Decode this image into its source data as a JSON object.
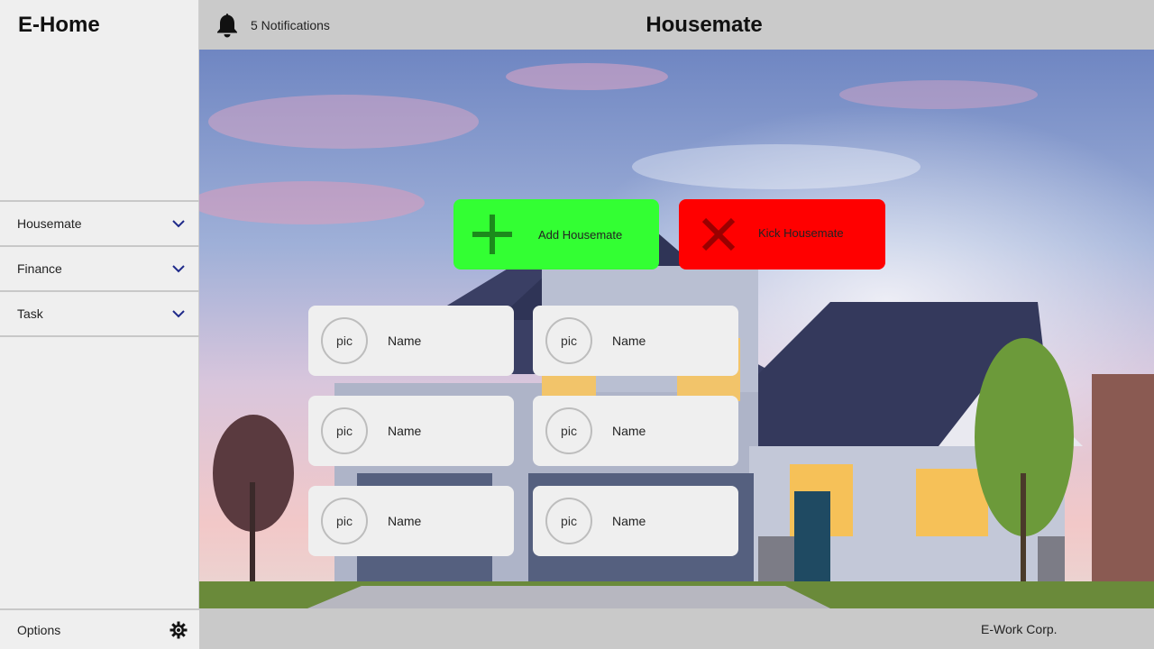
{
  "app": {
    "title": "E-Home"
  },
  "header": {
    "notifications_label": "5 Notifications",
    "page_title": "Housemate",
    "bell_icon": "bell-icon"
  },
  "sidebar": {
    "items": [
      {
        "label": "Housemate",
        "icon": "chevron-down-icon"
      },
      {
        "label": "Finance",
        "icon": "chevron-down-icon"
      },
      {
        "label": "Task",
        "icon": "chevron-down-icon"
      }
    ],
    "options_label": "Options",
    "options_icon": "gear-icon"
  },
  "actions": {
    "add_label": "Add Housemate",
    "add_icon": "plus-icon",
    "add_color": "#33ff33",
    "kick_label": "Kick Housemate",
    "kick_icon": "x-icon",
    "kick_color": "#ff0000"
  },
  "housemates": [
    {
      "pic": "pic",
      "name": "Name"
    },
    {
      "pic": "pic",
      "name": "Name"
    },
    {
      "pic": "pic",
      "name": "Name"
    },
    {
      "pic": "pic",
      "name": "Name"
    },
    {
      "pic": "pic",
      "name": "Name"
    },
    {
      "pic": "pic",
      "name": "Name"
    }
  ],
  "footer": {
    "company": "E-Work Corp."
  }
}
